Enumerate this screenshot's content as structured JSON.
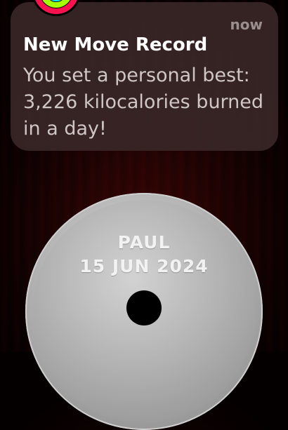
{
  "notification": {
    "app_icon": "activity-rings-icon",
    "timestamp": "now",
    "title": "New Move Record",
    "message": "You set a personal best: 3,226 kilocalories burned in a day!"
  },
  "award": {
    "name": "PAUL",
    "date": "15 JUN 2024"
  },
  "colors": {
    "move_ring": "#fa114f",
    "exercise_ring": "#a6ff00",
    "stand_ring": "#00f0ff",
    "background": "#1e0303",
    "card": "#3a2626"
  }
}
